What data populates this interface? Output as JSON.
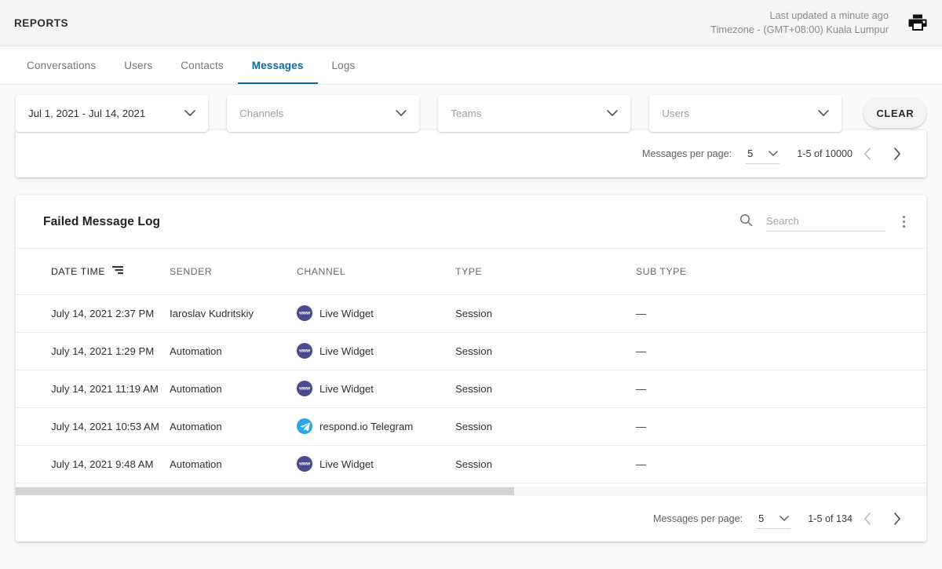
{
  "header": {
    "title": "REPORTS",
    "last_updated": "Last updated a minute ago",
    "timezone": "Timezone - (GMT+08:00) Kuala Lumpur",
    "print_icon": "printer-icon"
  },
  "tabs": [
    {
      "label": "Conversations",
      "active": false
    },
    {
      "label": "Users",
      "active": false
    },
    {
      "label": "Contacts",
      "active": false
    },
    {
      "label": "Messages",
      "active": true
    },
    {
      "label": "Logs",
      "active": false
    }
  ],
  "filters": {
    "date_range": {
      "value": "Jul 1, 2021 - Jul 14, 2021"
    },
    "channels": {
      "placeholder": "Channels"
    },
    "teams": {
      "placeholder": "Teams"
    },
    "users": {
      "placeholder": "Users"
    },
    "clear_label": "CLEAR"
  },
  "top_paginator": {
    "label": "Messages per page:",
    "page_size": "5",
    "range": "1-5 of 10000",
    "prev_icon": "chevron-left-icon",
    "next_icon": "chevron-right-icon"
  },
  "log": {
    "title": "Failed Message Log",
    "search_placeholder": "Search",
    "search_value": "",
    "search_icon": "search-icon",
    "menu_icon": "more-vertical-icon",
    "sort_icon": "sort-descending-icon",
    "columns": [
      {
        "label": "DATE TIME",
        "sorted": true
      },
      {
        "label": "SENDER",
        "sorted": false
      },
      {
        "label": "CHANNEL",
        "sorted": false
      },
      {
        "label": "TYPE",
        "sorted": false
      },
      {
        "label": "SUB TYPE",
        "sorted": false
      }
    ],
    "rows": [
      {
        "datetime": "July 14, 2021 2:37 PM",
        "sender": "Iaroslav Kudritskiy",
        "channel": "Live Widget",
        "channel_icon": "live-widget-icon",
        "channel_icon_label": "www",
        "type": "Session",
        "sub_type": "—"
      },
      {
        "datetime": "July 14, 2021 1:29 PM",
        "sender": "Automation",
        "channel": "Live Widget",
        "channel_icon": "live-widget-icon",
        "channel_icon_label": "www",
        "type": "Session",
        "sub_type": "—"
      },
      {
        "datetime": "July 14, 2021 11:19 AM",
        "sender": "Automation",
        "channel": "Live Widget",
        "channel_icon": "live-widget-icon",
        "channel_icon_label": "www",
        "type": "Session",
        "sub_type": "—"
      },
      {
        "datetime": "July 14, 2021 10:53 AM",
        "sender": "Automation",
        "channel": "respond.io Telegram",
        "channel_icon": "telegram-icon",
        "channel_icon_label": "",
        "type": "Session",
        "sub_type": "—"
      },
      {
        "datetime": "July 14, 2021 9:48 AM",
        "sender": "Automation",
        "channel": "Live Widget",
        "channel_icon": "live-widget-icon",
        "channel_icon_label": "www",
        "type": "Session",
        "sub_type": "—"
      }
    ],
    "paginator": {
      "label": "Messages per page:",
      "page_size": "5",
      "range": "1-5 of 134",
      "prev_icon": "chevron-left-icon",
      "next_icon": "chevron-right-icon"
    }
  },
  "colors": {
    "accent": "#0b6aa2",
    "live_widget": "#4c4b8a",
    "telegram": "#2ca5e0",
    "page_bg": "#fafafa"
  }
}
